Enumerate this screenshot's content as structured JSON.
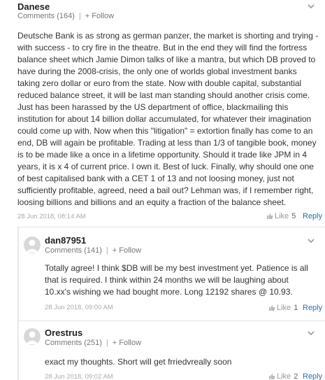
{
  "comments": [
    {
      "author": "Danese",
      "comments_label": "Comments (164)",
      "follow_label": "+ Follow",
      "body": [
        "Deutsche Bank is as strong as german panzer, the market is shorting and trying -",
        "with success - to cry fire in the theatre. But in the end they will find the fortress",
        "balance sheet which Jamie Dimon talks of like a mantra, but which DB proved to",
        "have during the 2008-crisis, the only one of worlds global investment banks",
        "taking zero dollar or euro from the state. Now with double capital, substantial",
        "reduced balance street, it will be last man standing should another crisis come.",
        "Just has been harassed by the US department of office, blackmailing this",
        "institution for about 14 billion dollar accumulated, for whatever their imagination",
        "could come up with. Now when this \"litigation\" = extortion finally has come to an",
        "end, DB will again be profitable. Trading at less than 1/3 of tangible book, money",
        "is to be made like a once in a lifetime opportunity. Should it trade like JPM in 4",
        "years, it is x 4 of current price. I own it. Best of luck. Finally, why should one one",
        "of best capitalised bank with a CET 1 of 13 and not loosing money, just not",
        "sufficiently profitable, agreed, need a bail out? Lehman was, if I remember right,",
        "loosing billions and billions and an equity a fraction of the balance sheet."
      ],
      "timestamp": "28 Jun 2018, 08:14 AM",
      "like_label": "Like",
      "like_count": "5",
      "reply_label": "Reply"
    },
    {
      "author": "dan87951",
      "comments_label": "Comments (141)",
      "follow_label": "+ Follow",
      "body": [
        "Totally agree! I think $DB will be my best investment yet. Patience is all",
        "that is required. I think within 24 months we will be laughing about",
        "10.xx's wishing we had bought more. Long 12192 shares @ 10.93."
      ],
      "timestamp": "28 Jun 2018, 09:00 AM",
      "like_label": "Like",
      "like_count": "1",
      "reply_label": "Reply"
    },
    {
      "author": "Orestrus",
      "comments_label": "Comments (251)",
      "follow_label": "+ Follow",
      "body": [
        "exact my thoughts. Short will get frriedvreally soon"
      ],
      "timestamp": "28 Jun 2018, 09:02 AM",
      "like_label": "Like",
      "like_count": "2",
      "reply_label": "Reply"
    }
  ],
  "colors": {
    "link": "#2a6fb3",
    "meta": "#777777",
    "timestamp": "#aaaaaa",
    "divider": "#e5e5e5"
  },
  "icons": [
    "chevron-down-icon",
    "thumbs-up-icon",
    "user-avatar-icon"
  ]
}
